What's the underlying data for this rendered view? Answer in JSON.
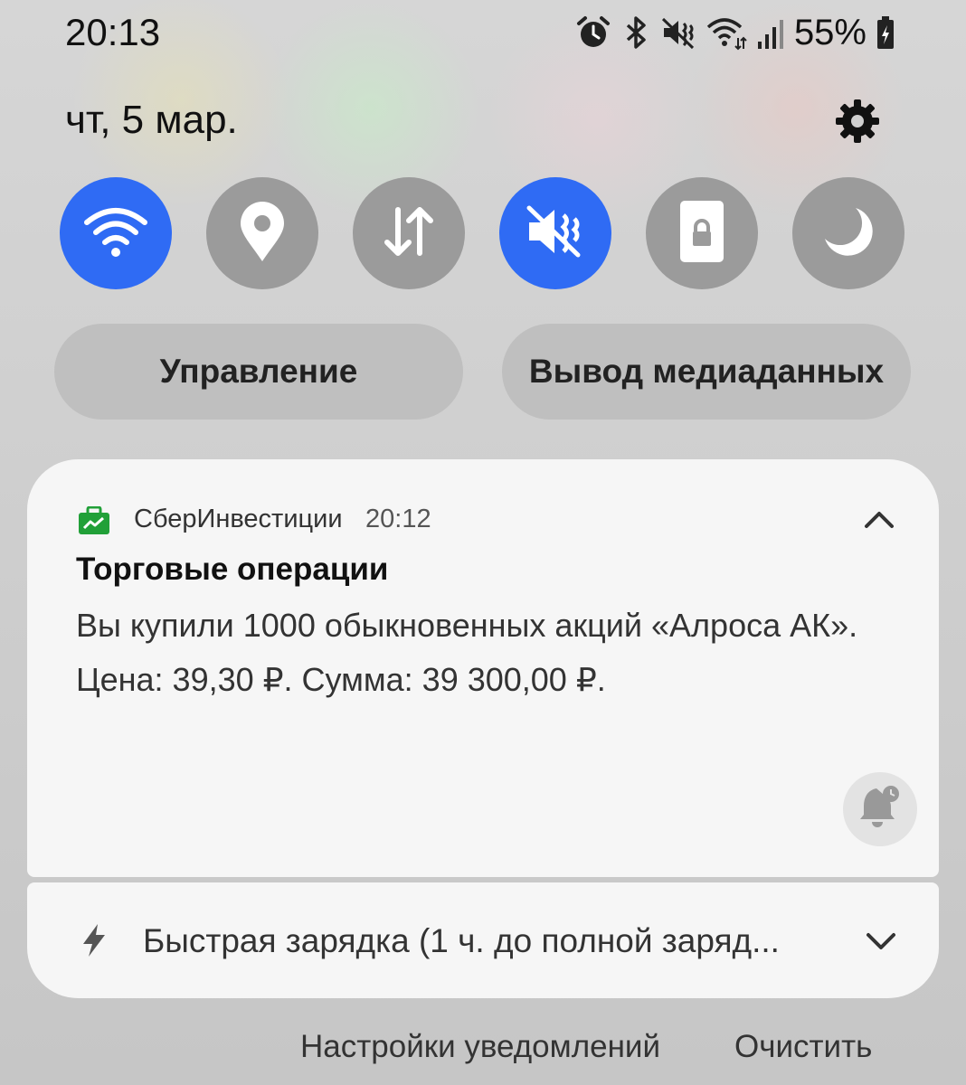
{
  "status_bar": {
    "time": "20:13",
    "battery": "55%",
    "icons": [
      "alarm-icon",
      "bluetooth-icon",
      "silent-vibrate-icon",
      "wifi-icon",
      "signal-icon",
      "battery-charging-icon"
    ]
  },
  "header": {
    "date": "чт, 5 мар.",
    "settings_icon": "gear-icon"
  },
  "quick_tiles": [
    {
      "icon": "wifi-icon",
      "active": true
    },
    {
      "icon": "location-icon",
      "active": false
    },
    {
      "icon": "mobile-data-icon",
      "active": false
    },
    {
      "icon": "mute-icon",
      "active": true
    },
    {
      "icon": "rotation-lock-icon",
      "active": false
    },
    {
      "icon": "night-mode-icon",
      "active": false
    }
  ],
  "pills": {
    "control": "Управление",
    "media_output": "Вывод медиаданных"
  },
  "notification": {
    "app_name": "СберИнвестиции",
    "time": "20:12",
    "title": "Торговые операции",
    "body": "Вы купили 1000 обыкновенных акций «Алроса АК». Цена: 39,30 ₽. Сумма: 39 300,00 ₽."
  },
  "charging": {
    "text": "Быстрая зарядка (1 ч. до полной заряд..."
  },
  "actions": {
    "settings": "Настройки уведомлений",
    "clear": "Очистить"
  },
  "colors": {
    "accent": "#2f6bf4",
    "tile_off": "#9b9b9b",
    "sber_green": "#21a038"
  }
}
